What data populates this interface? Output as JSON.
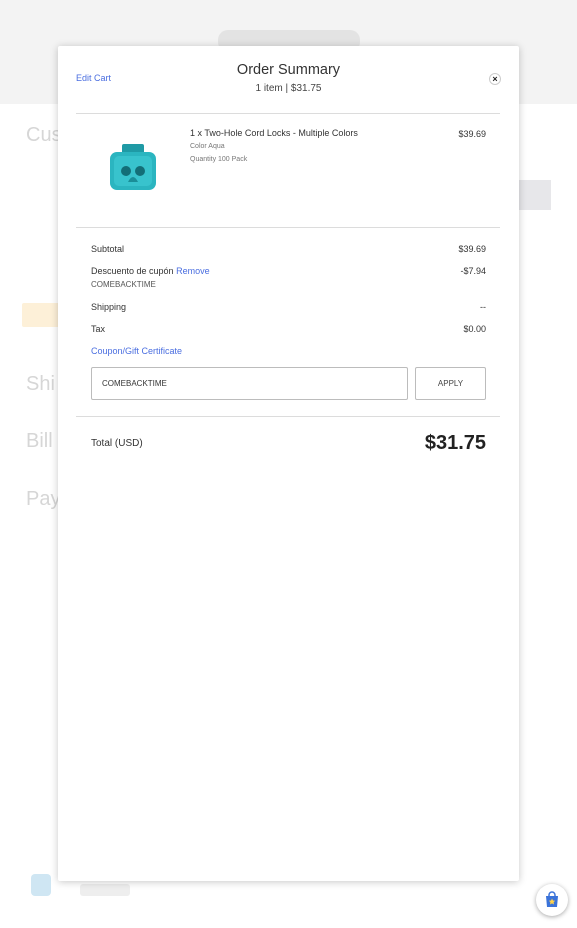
{
  "modal": {
    "edit_cart": "Edit Cart",
    "title": "Order Summary",
    "subtitle": "1 item | $31.75",
    "close_symbol": "×"
  },
  "item": {
    "name": "1 x Two-Hole Cord Locks - Multiple Colors",
    "options": [
      "Color Aqua",
      "Quantity 100 Pack"
    ],
    "price": "$39.69",
    "image_color": "#2bb5c0"
  },
  "totals": {
    "subtotal_label": "Subtotal",
    "subtotal_value": "$39.69",
    "discount_label": "Descuento de cupón",
    "remove_label": "Remove",
    "discount_value": "-$7.94",
    "coupon_code": "COMEBACKTIME",
    "shipping_label": "Shipping",
    "shipping_value": "--",
    "tax_label": "Tax",
    "tax_value": "$0.00",
    "coupon_link": "Coupon/Gift Certificate",
    "coupon_input_value": "COMEBACKTIME",
    "apply_label": "APPLY",
    "total_label": "Total (USD)",
    "total_value": "$31.75"
  },
  "colors": {
    "link": "#4a6ee0",
    "accent_background": "#fdf0d8"
  }
}
